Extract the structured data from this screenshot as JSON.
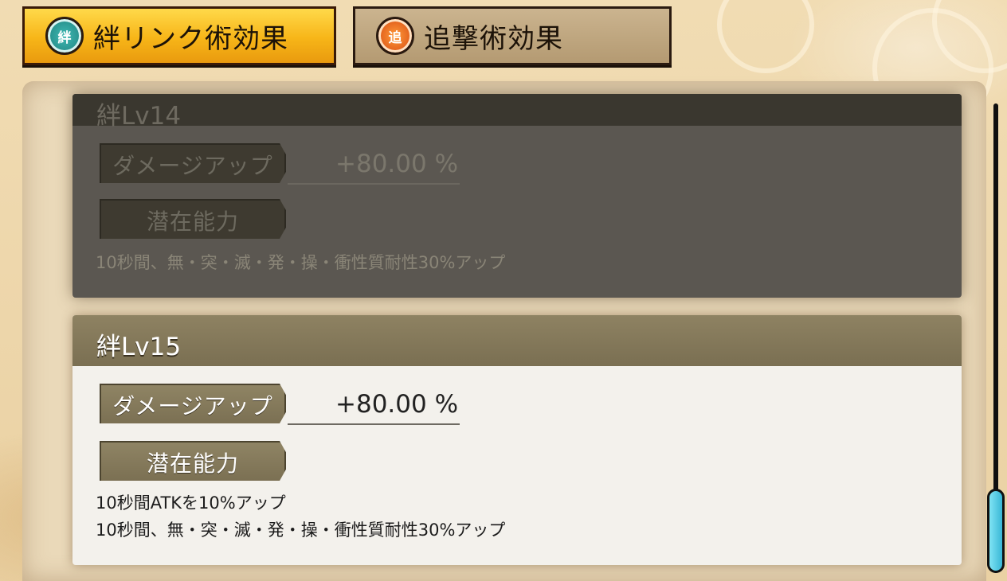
{
  "tabs": [
    {
      "badge": "絆",
      "label": "絆リンク術効果",
      "active": true
    },
    {
      "badge": "追",
      "label": "追撃術効果",
      "active": false
    }
  ],
  "cards": [
    {
      "title": "絆Lv14",
      "stat_label": "ダメージアップ",
      "stat_value": "+80.00 %",
      "ability_label": "潜在能力",
      "descriptions": [
        "10秒間、無・突・滅・発・操・衝性質耐性30%アップ"
      ],
      "state": "dimmed"
    },
    {
      "title": "絆Lv15",
      "stat_label": "ダメージアップ",
      "stat_value": "+80.00 %",
      "ability_label": "潜在能力",
      "descriptions": [
        "10秒間ATKを10%アップ",
        "10秒間、無・突・滅・発・操・衝性質耐性30%アップ"
      ],
      "state": "active"
    }
  ],
  "scrollbar": {
    "position": 1.0
  },
  "colors": {
    "active_tab": "#f7b518",
    "inactive_tab": "#b49a72",
    "scroll_thumb": "#38b7d6",
    "card_header": "#7a6f52"
  }
}
